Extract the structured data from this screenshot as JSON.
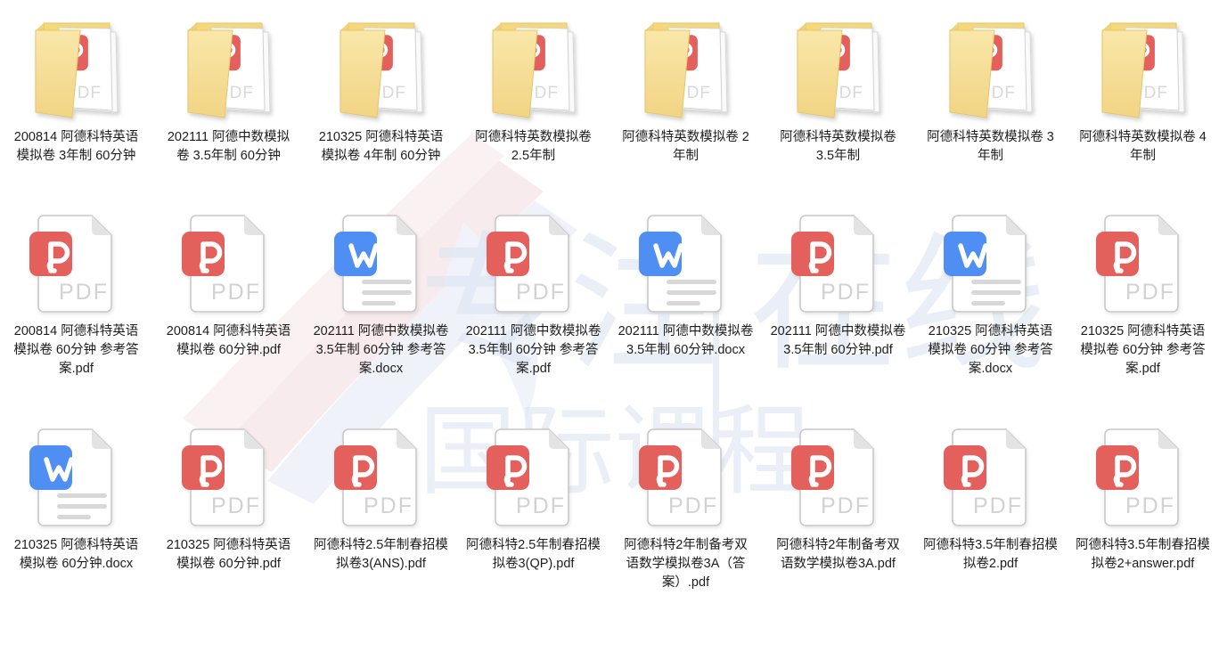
{
  "view": {
    "title": "文件夹内容视图",
    "layout": "icon-grid",
    "columns": 8,
    "rows": 3,
    "background_color": "#ffffff"
  },
  "colors": {
    "folder_front": "#f7e094",
    "folder_back": "#f5d77c",
    "folder_edge": "#e3c76a",
    "paper_white": "#ffffff",
    "paper_border": "#c8c8c8",
    "pdf_badge": "#e4605c",
    "word_badge": "#4f8ef3",
    "pdf_text": "#d2d2d2",
    "doc_line": "#d8d8d8",
    "label_text": "#1d1d1d",
    "watermark_blue": "#dfe7f3",
    "watermark_pink": "#f6dfe2"
  },
  "watermark": {
    "text_primary": "专注在线",
    "text_secondary": "国际课程",
    "separator": "|",
    "opacity": "0.5"
  },
  "icons": {
    "folder_pdf": "folder-with-pdf-icon",
    "folder_word": "folder-with-word-icon",
    "file_pdf": "pdf-file-icon",
    "file_word": "word-file-icon",
    "pdf_label": "PDF"
  },
  "items": [
    {
      "name": "200814 阿德科特英语模拟卷 3年制 60分钟",
      "type": "folder",
      "inner": "pdf"
    },
    {
      "name": "202111 阿德中数模拟卷 3.5年制 60分钟",
      "type": "folder",
      "inner": "pdf"
    },
    {
      "name": "210325 阿德科特英语模拟卷 4年制 60分钟",
      "type": "folder",
      "inner": "word"
    },
    {
      "name": "阿德科特英数模拟卷 2.5年制",
      "type": "folder",
      "inner": "pdf"
    },
    {
      "name": "阿德科特英数模拟卷 2年制",
      "type": "folder",
      "inner": "pdf"
    },
    {
      "name": "阿德科特英数模拟卷 3.5年制",
      "type": "folder",
      "inner": "pdf"
    },
    {
      "name": "阿德科特英数模拟卷 3年制",
      "type": "folder",
      "inner": "pdf"
    },
    {
      "name": "阿德科特英数模拟卷 4年制",
      "type": "folder",
      "inner": "pdf"
    },
    {
      "name": "200814 阿德科特英语模拟卷 60分钟 参考答案.pdf",
      "type": "pdf"
    },
    {
      "name": "200814 阿德科特英语模拟卷 60分钟.pdf",
      "type": "pdf"
    },
    {
      "name": "202111 阿德中数模拟卷 3.5年制 60分钟 参考答案.docx",
      "type": "word"
    },
    {
      "name": "202111 阿德中数模拟卷 3.5年制 60分钟 参考答案.pdf",
      "type": "pdf"
    },
    {
      "name": "202111 阿德中数模拟卷 3.5年制 60分钟.docx",
      "type": "word"
    },
    {
      "name": "202111 阿德中数模拟卷 3.5年制 60分钟.pdf",
      "type": "pdf"
    },
    {
      "name": "210325 阿德科特英语模拟卷 60分钟 参考答案.docx",
      "type": "word"
    },
    {
      "name": "210325 阿德科特英语模拟卷 60分钟 参考答案.pdf",
      "type": "pdf"
    },
    {
      "name": "210325 阿德科特英语模拟卷 60分钟.docx",
      "type": "word"
    },
    {
      "name": "210325 阿德科特英语模拟卷 60分钟.pdf",
      "type": "pdf"
    },
    {
      "name": "阿德科特2.5年制春招模拟卷3(ANS).pdf",
      "type": "pdf"
    },
    {
      "name": "阿德科特2.5年制春招模拟卷3(QP).pdf",
      "type": "pdf"
    },
    {
      "name": "阿德科特2年制备考双语数学模拟卷3A（答案）.pdf",
      "type": "pdf"
    },
    {
      "name": "阿德科特2年制备考双语数学模拟卷3A.pdf",
      "type": "pdf"
    },
    {
      "name": "阿德科特3.5年制春招模拟卷2.pdf",
      "type": "pdf"
    },
    {
      "name": "阿德科特3.5年制春招模拟卷2+answer.pdf",
      "type": "pdf"
    }
  ]
}
